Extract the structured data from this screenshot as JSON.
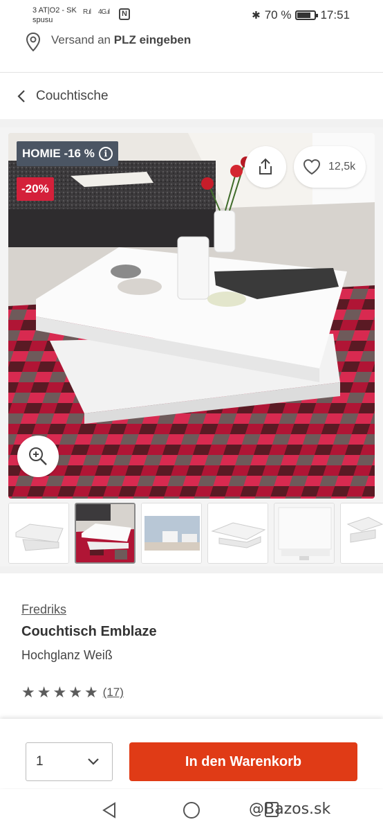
{
  "status_bar": {
    "carrier_line1": "3 AT|O2 - SK",
    "carrier_line2": "spusu",
    "signal1": "R.ıl",
    "signal2": "4G.ıl",
    "battery": "70 %",
    "time": "17:51"
  },
  "shipping": {
    "prefix": "Versand an",
    "action": "PLZ eingeben"
  },
  "breadcrumb": {
    "label": "Couchtische"
  },
  "badges": {
    "homie": "HOMIE -16 %",
    "discount": "-20%"
  },
  "favorites": {
    "count": "12,5k"
  },
  "product": {
    "brand": "Fredriks",
    "title": "Couchtisch Emblaze",
    "subtitle": "Hochglanz Weiß",
    "rating": 5,
    "review_count": "(17)"
  },
  "purchase": {
    "quantity": "1",
    "cart_button": "In den Warenkorb"
  },
  "watermark": "@Bazos.sk",
  "icons": {
    "location": "pin-icon",
    "back": "chevron-left-icon",
    "share": "share-icon",
    "favorite": "heart-icon",
    "zoom": "zoom-in-icon",
    "info": "info-icon"
  },
  "colors": {
    "discount_red": "#d4203a",
    "cart_orange": "#e03b16",
    "badge_gray": "#4b5563"
  }
}
